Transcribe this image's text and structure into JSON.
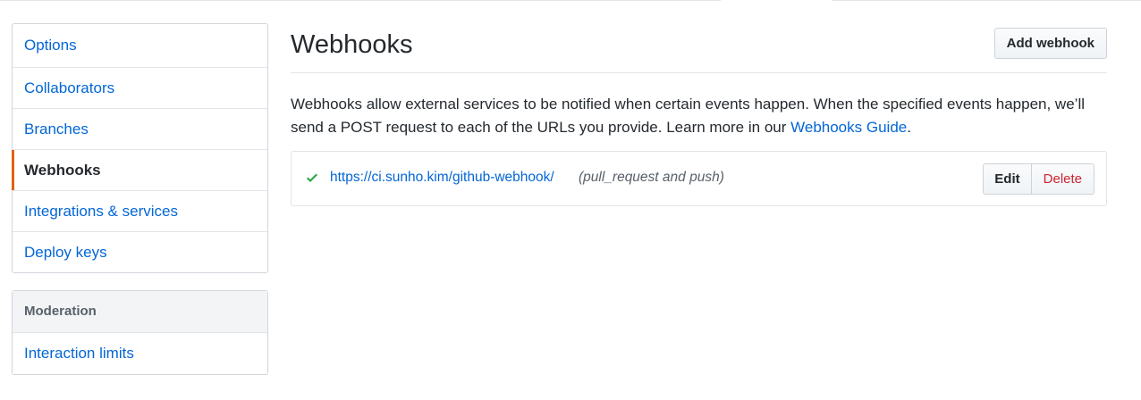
{
  "sidebar": {
    "items": [
      {
        "label": "Options"
      },
      {
        "label": "Collaborators"
      },
      {
        "label": "Branches"
      },
      {
        "label": "Webhooks"
      },
      {
        "label": "Integrations & services"
      },
      {
        "label": "Deploy keys"
      }
    ],
    "selected": "Webhooks",
    "moderation": {
      "heading": "Moderation",
      "items": [
        {
          "label": "Interaction limits"
        }
      ]
    }
  },
  "main": {
    "title": "Webhooks",
    "add_button": "Add webhook",
    "description": "Webhooks allow external services to be notified when certain events happen. When the specified events happen, we’ll send a POST request to each of the URLs you provide. Learn more in our",
    "guide_link": "Webhooks Guide",
    "description_end": ".",
    "webhook": {
      "status_icon": "check-icon",
      "url": "https://ci.sunho.kim/github-webhook/",
      "events": "(pull_request and push)",
      "edit_label": "Edit",
      "delete_label": "Delete"
    }
  },
  "colors": {
    "link": "#0366d6",
    "selected_accent": "#e36209",
    "success": "#28a745",
    "danger": "#cb2431"
  }
}
